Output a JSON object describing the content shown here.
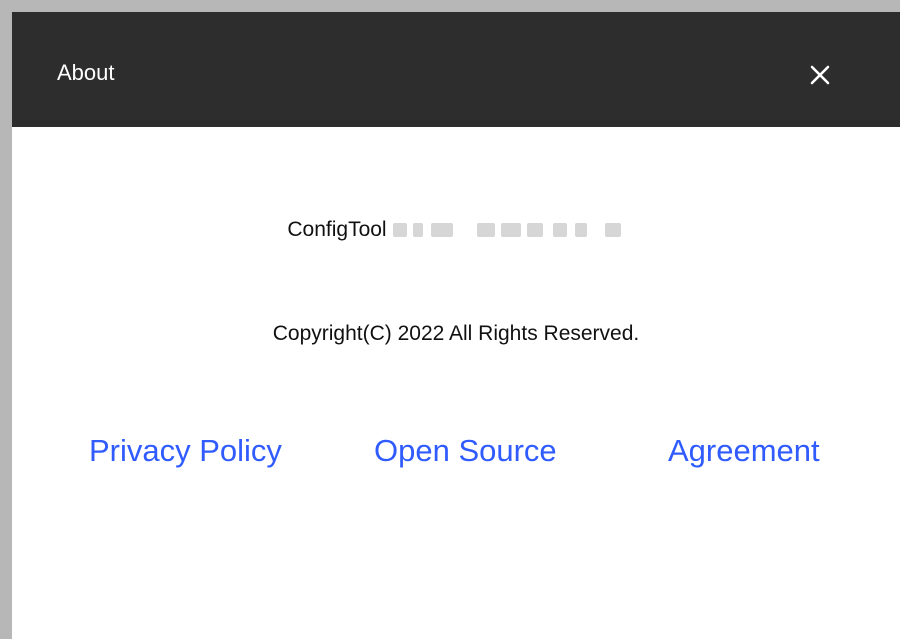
{
  "dialog": {
    "title": "About",
    "close_icon": "close-icon"
  },
  "product": {
    "name": "ConfigTool"
  },
  "copyright": "Copyright(C) 2022 All Rights Reserved.",
  "links": {
    "privacy_policy": "Privacy Policy",
    "open_source": "Open Source",
    "agreement": "Agreement"
  },
  "colors": {
    "titlebar": "#2d2d2d",
    "link": "#2f5bff",
    "text": "#111111"
  }
}
